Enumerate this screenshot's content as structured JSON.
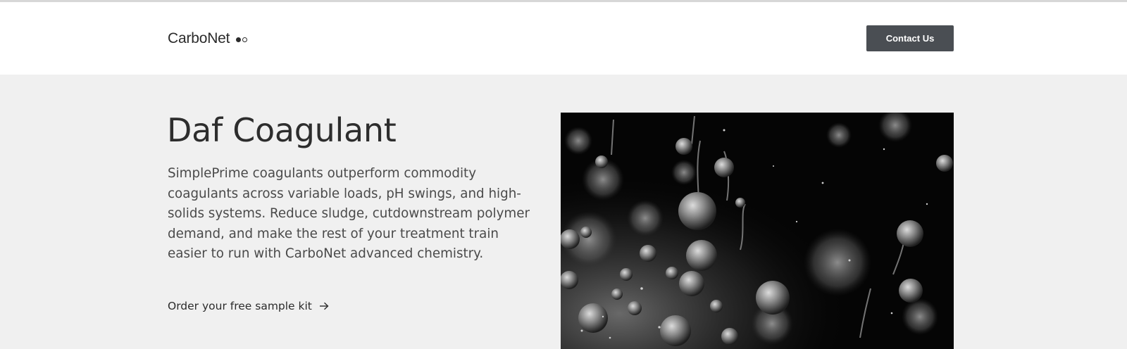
{
  "header": {
    "logo_text": "CarboNet",
    "logo_icon": "two-dots-logo-mark-icon",
    "contact_label": "Contact Us"
  },
  "hero": {
    "title": "Daf Coagulant",
    "description_lines": [
      "SimplePrime coagulants outperform commodity",
      "coagulants across variable loads, pH swings, and high-",
      "solids systems. Reduce sludge, cutdownstream polymer",
      "demand, and make the rest of your treatment train",
      "easier to run with CarboNet advanced chemistry."
    ],
    "cta_label": "Order your free sample kit",
    "cta_icon": "arrow-right-icon",
    "image": "black-and-white macro photo of floating spherical coagulant particles"
  },
  "colors": {
    "button_bg": "#4a4e53",
    "hero_bg": "#f0f0f0",
    "text": "#2b2b2b"
  }
}
